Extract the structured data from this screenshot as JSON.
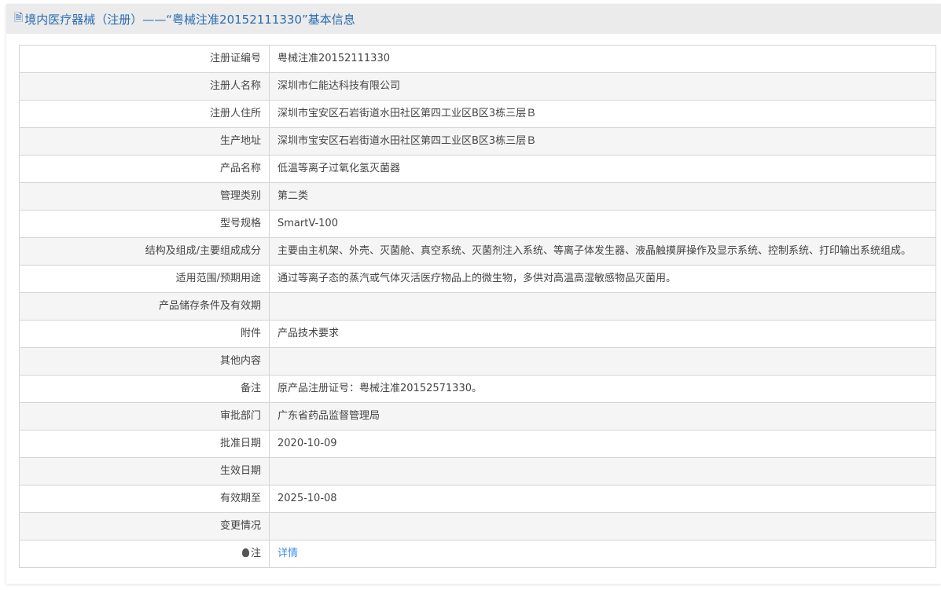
{
  "header": {
    "title": "境内医疗器械（注册）——“粤械注准20152111330”基本信息",
    "icon": "document-icon"
  },
  "rows": [
    {
      "label": "注册证编号",
      "value": "粤械注准20152111330"
    },
    {
      "label": "注册人名称",
      "value": "深圳市仁能达科技有限公司"
    },
    {
      "label": "注册人住所",
      "value": "深圳市宝安区石岩街道水田社区第四工业区B区3栋三层Ｂ"
    },
    {
      "label": "生产地址",
      "value": "深圳市宝安区石岩街道水田社区第四工业区B区3栋三层Ｂ"
    },
    {
      "label": "产品名称",
      "value": "低温等离子过氧化氢灭菌器"
    },
    {
      "label": "管理类别",
      "value": "第二类"
    },
    {
      "label": "型号规格",
      "value": "SmartV-100"
    },
    {
      "label": "结构及组成/主要组成成分",
      "value": "主要由主机架、外壳、灭菌舱、真空系统、灭菌剂注入系统、等离子体发生器、液晶触摸屏操作及显示系统、控制系统、打印输出系统组成。"
    },
    {
      "label": "适用范围/预期用途",
      "value": "通过等离子态的蒸汽或气体灭活医疗物品上的微生物，多供对高温高湿敏感物品灭菌用。"
    },
    {
      "label": "产品储存条件及有效期",
      "value": ""
    },
    {
      "label": "附件",
      "value": "产品技术要求"
    },
    {
      "label": "其他内容",
      "value": ""
    },
    {
      "label": "备注",
      "value": "原产品注册证号：粤械注准20152571330。"
    },
    {
      "label": "审批部门",
      "value": "广东省药品监督管理局"
    },
    {
      "label": "批准日期",
      "value": "2020-10-09"
    },
    {
      "label": "生效日期",
      "value": ""
    },
    {
      "label": "有效期至",
      "value": "2025-10-08"
    },
    {
      "label": "变更情况",
      "value": ""
    }
  ],
  "note": {
    "label": "注",
    "link": "详情",
    "icon": "lightbulb-icon"
  }
}
